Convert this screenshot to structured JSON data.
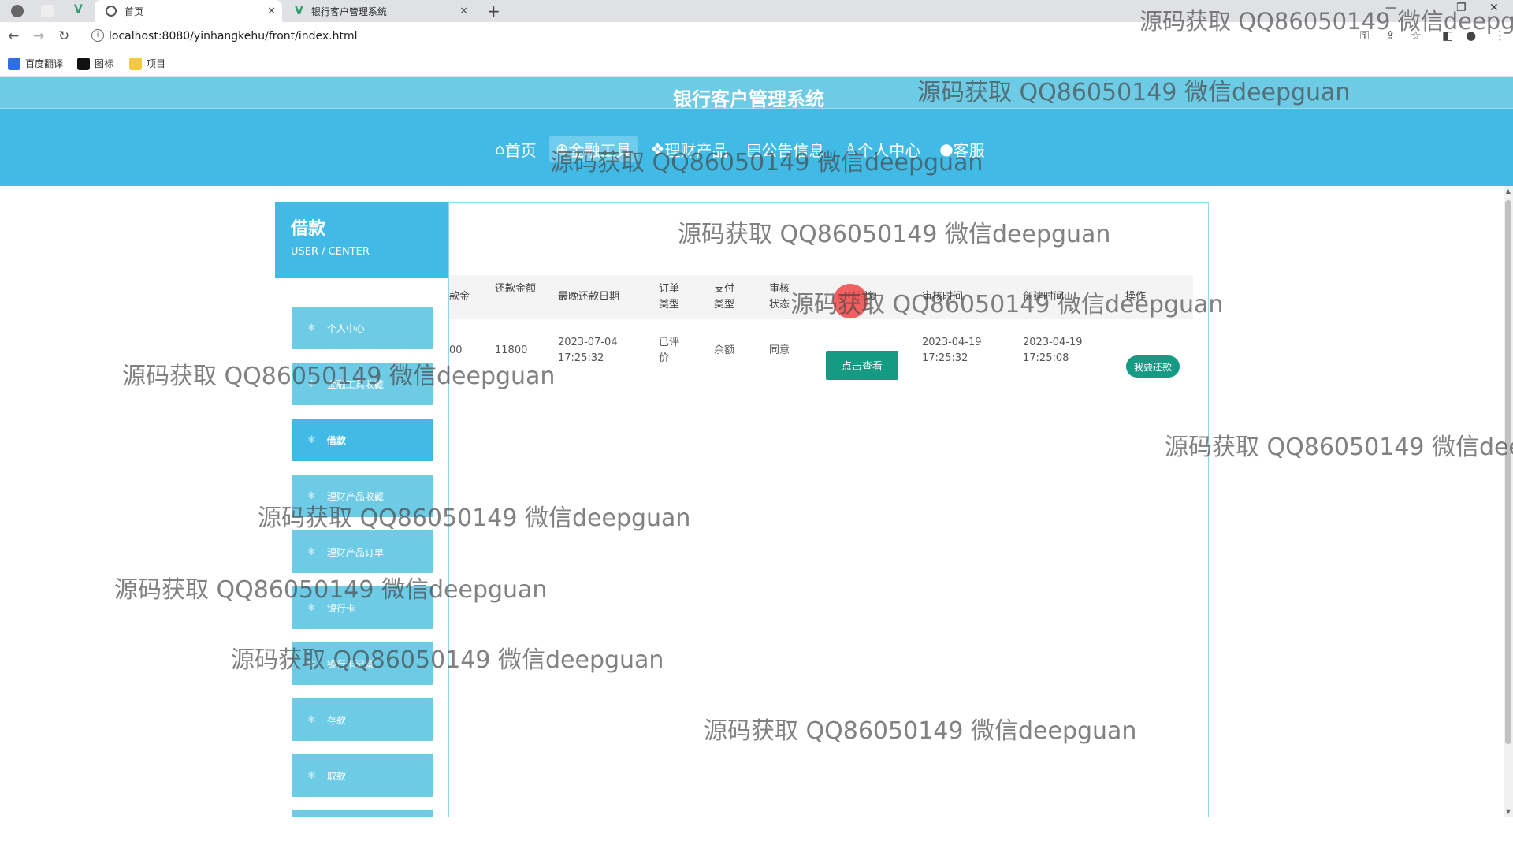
{
  "browser": {
    "tabs": [
      {
        "title": "首页",
        "active": true
      },
      {
        "title": "银行客户管理系统",
        "active": false
      }
    ],
    "url": "localhost:8080/yinhangkehu/front/index.html",
    "bookmarks": [
      "百度翻译",
      "图标",
      "项目"
    ]
  },
  "site": {
    "title": "银行客户管理系统",
    "nav": [
      {
        "icon": "⌂",
        "label": "首页"
      },
      {
        "icon": "⊕",
        "label": "金融工具"
      },
      {
        "icon": "❖",
        "label": "理财产品"
      },
      {
        "icon": "▤",
        "label": "公告信息"
      },
      {
        "icon": "♙",
        "label": "个人中心"
      },
      {
        "icon": "●",
        "label": "客服"
      }
    ],
    "active_nav": "金融工具"
  },
  "sidebar": {
    "title": "借款",
    "subtitle": "USER / CENTER",
    "items": [
      "个人中心",
      "金融工具收藏",
      "借款",
      "理财产品收藏",
      "理财产品订单",
      "银行卡",
      "银行卡记录",
      "存款",
      "取款"
    ],
    "active": "借款"
  },
  "table": {
    "headers": [
      "款金",
      "还款金额",
      "最晚还款日期",
      "订单类型",
      "支付类型",
      "审核状态",
      "审核回复",
      "审核时间",
      "创建时间",
      "操作"
    ],
    "row": {
      "amount_partial": "00",
      "repay_amount": "11800",
      "deadline": "2023-07-04 17:25:32",
      "order_type": "已评价",
      "pay_type": "余额",
      "status": "同意",
      "reply_button": "点击查看",
      "review_time": "2023-04-19 17:25:32",
      "created_time": "2023-04-19 17:25:08",
      "action": "我要还款"
    }
  },
  "watermark": "源码获取 QQ86050149 微信deepguan",
  "colors": {
    "primary": "#41bbe6",
    "light": "#6ecbe6",
    "button": "#159a84"
  }
}
